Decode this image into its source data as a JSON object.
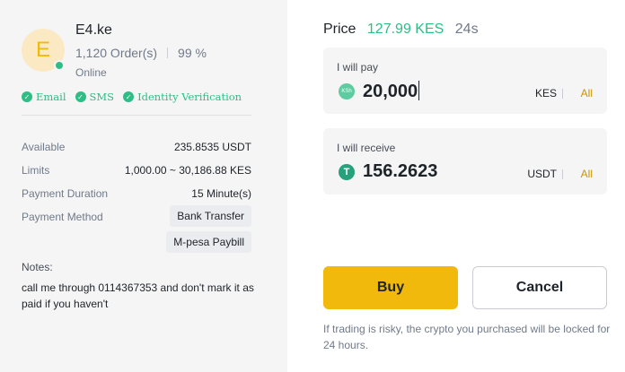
{
  "merchant": {
    "avatar_letter": "E",
    "name": "E4.ke",
    "orders": "1,120 Order(s)",
    "completion": "99 %",
    "status": "Online",
    "verifications": [
      "Email",
      "SMS",
      "Identity Verification"
    ]
  },
  "details": {
    "available_label": "Available",
    "available_value": "235.8535 USDT",
    "limits_label": "Limits",
    "limits_value": "1,000.00 ~ 30,186.88 KES",
    "duration_label": "Payment Duration",
    "duration_value": "15 Minute(s)",
    "method_label": "Payment Method",
    "methods": [
      "Bank Transfer",
      "M-pesa Paybill"
    ]
  },
  "notes": {
    "label": "Notes:",
    "text": "call me through 0114367353 and don't mark it as paid if you haven't"
  },
  "price": {
    "label": "Price",
    "value": "127.99 KES",
    "timer": "24s"
  },
  "pay": {
    "label": "I will pay",
    "coin_icon_text": "KSh",
    "amount": "20,000",
    "currency": "KES",
    "all_label": "All"
  },
  "receive": {
    "label": "I will receive",
    "coin_icon_text": "T",
    "amount": "156.2623",
    "currency": "USDT",
    "all_label": "All"
  },
  "actions": {
    "buy_label": "Buy",
    "cancel_label": "Cancel"
  },
  "warning": "If trading is risky, the crypto you purchased will be locked for 24 hours.",
  "colors": {
    "accent_yellow": "#f0b90b",
    "success_green": "#2ebd85",
    "link_gold": "#c99400",
    "usdt_green": "#26a17b"
  }
}
